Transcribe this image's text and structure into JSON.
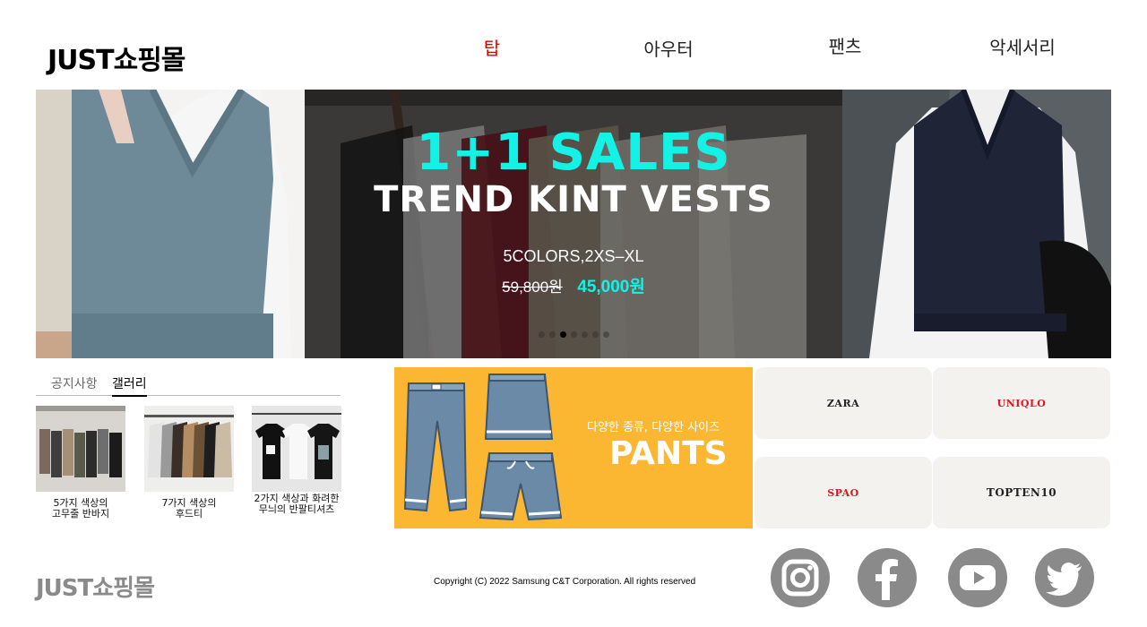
{
  "header": {
    "logo": "JUST쇼핑몰",
    "nav": [
      {
        "label": "탑",
        "active": true
      },
      {
        "label": "아우터",
        "active": false
      },
      {
        "label": "팬츠",
        "active": false
      },
      {
        "label": "악세서리",
        "active": false
      }
    ]
  },
  "banner": {
    "headline": "1+1 SALES",
    "subheadline": "TREND KINT VESTS",
    "options": "5COLORS,2XS–XL",
    "original_price": "59,800원",
    "sale_price": "45,000원",
    "slide_count": 7,
    "active_slide": 3
  },
  "board": {
    "tabs": [
      {
        "label": "공지사항",
        "active": false
      },
      {
        "label": "갤러리",
        "active": true
      }
    ],
    "gallery": [
      {
        "caption": "5가지 색상의 고무줄 반바지"
      },
      {
        "caption": "7가지 색상의 후드티"
      },
      {
        "caption": "2가지 색상과 화려한 무늬의 반팔티셔츠"
      }
    ]
  },
  "pants_banner": {
    "subtitle": "다양한 종류, 다양한 사이즈",
    "title": "PANTS"
  },
  "brands": [
    {
      "name": "ZARA",
      "color": "#222222"
    },
    {
      "name": "UNIQLO",
      "color": "#e0141e"
    },
    {
      "name": "SPAO",
      "color": "#e0141e"
    },
    {
      "name": "TOPTEN10",
      "color": "#222222"
    }
  ],
  "footer": {
    "logo": "JUST쇼핑몰",
    "copyright": "Copyright (C) 2022 Samsung C&T Corporation. All rights reserved",
    "social": [
      "instagram-icon",
      "facebook-icon",
      "youtube-icon",
      "twitter-icon"
    ]
  },
  "colors": {
    "accent_cyan": "#14f2e6",
    "nav_active": "#e00000",
    "pants_bg": "#fbb731",
    "social_gray": "#8a8a8a"
  }
}
